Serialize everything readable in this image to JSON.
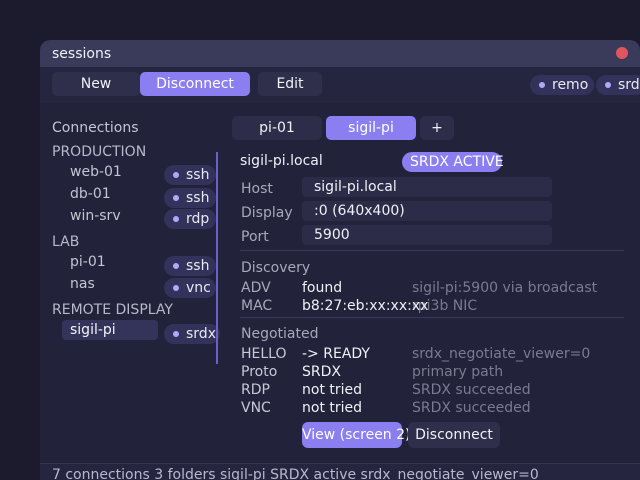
{
  "window": {
    "title": "sessions"
  },
  "toolbar": {
    "new_label": "New",
    "disconnect_label": "Disconnect",
    "edit_label": "Edit",
    "chips": [
      "remo",
      "srdx"
    ]
  },
  "sidebar": {
    "heading": "Connections",
    "groups": [
      {
        "name": "PRODUCTION",
        "items": [
          {
            "label": "web-01",
            "proto": "ssh"
          },
          {
            "label": "db-01",
            "proto": "ssh"
          },
          {
            "label": "win-srv",
            "proto": "rdp"
          }
        ]
      },
      {
        "name": "LAB",
        "items": [
          {
            "label": "pi-01",
            "proto": "ssh"
          },
          {
            "label": "nas",
            "proto": "vnc"
          }
        ]
      },
      {
        "name": "REMOTE DISPLAY",
        "items": [
          {
            "label": "sigil-pi",
            "proto": "srdx",
            "selected": true
          }
        ]
      }
    ]
  },
  "tabs": [
    {
      "label": "pi-01"
    },
    {
      "label": "sigil-pi",
      "active": true
    },
    {
      "label": "+"
    }
  ],
  "detail": {
    "hostname": "sigil-pi.local",
    "badge": "SRDX ACTIVE",
    "host_label": "Host",
    "host_value": "sigil-pi.local",
    "display_label": "Display",
    "display_value": ":0  (640x400)",
    "port_label": "Port",
    "port_value": "5900",
    "discovery": {
      "heading": "Discovery",
      "rows": [
        {
          "k": "ADV",
          "v": "found",
          "note": "sigil-pi:5900 via broadcast"
        },
        {
          "k": "MAC",
          "v": "b8:27:eb:xx:xx:xx",
          "note": "rpi3b NIC"
        }
      ]
    },
    "negotiated": {
      "heading": "Negotiated",
      "rows": [
        {
          "k": "HELLO",
          "v": "-> READY",
          "note": "srdx_negotiate_viewer=0"
        },
        {
          "k": "Proto",
          "v": "SRDX",
          "note": "primary path"
        },
        {
          "k": "RDP",
          "v": "not tried",
          "note": "SRDX succeeded"
        },
        {
          "k": "VNC",
          "v": "not tried",
          "note": "SRDX succeeded"
        }
      ]
    },
    "view_label": "View (screen 2)",
    "disconnect_label": "Disconnect"
  },
  "status": {
    "text": "7 connections   3 folders   sigil-pi SRDX active   srdx_negotiate_viewer=0"
  },
  "colors": {
    "accent": "#8a7ef0",
    "background": "#22223a",
    "titlebar": "#3a3a5a",
    "close": "#e0555f"
  }
}
